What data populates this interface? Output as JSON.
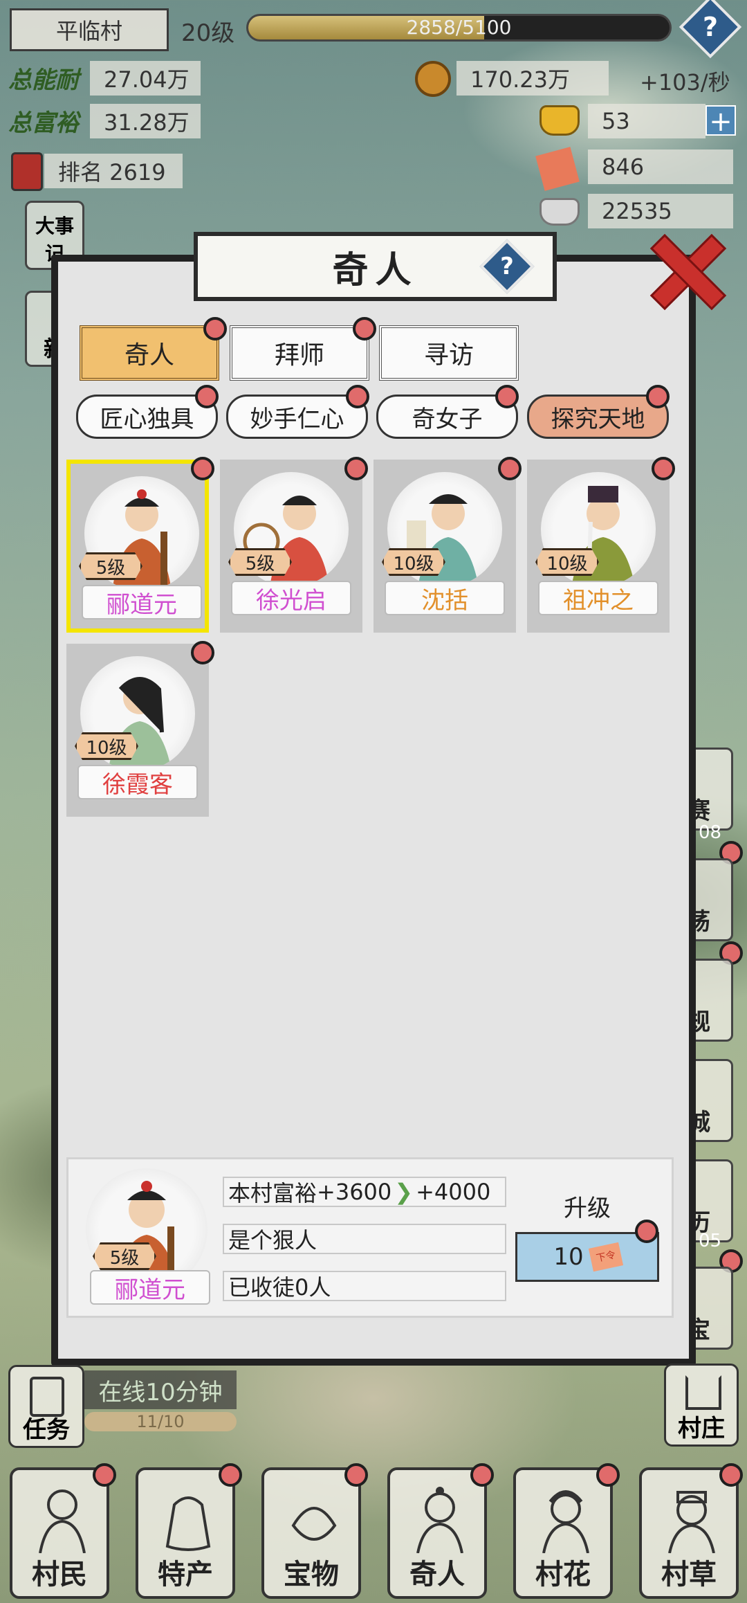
{
  "hud": {
    "village": "平临村",
    "level": "20级",
    "exp_text": "2858/5100",
    "exp_progress": 0.56,
    "talent_label": "总能耐",
    "talent_value": "27.04万",
    "wealth_label": "总富裕",
    "wealth_value": "31.28万",
    "rank": "排名 2619",
    "coins": "170.23万",
    "coin_rate": "+103/秒",
    "gold": "53",
    "tickets": "846",
    "silver": "22535",
    "help_glyph": "?",
    "plus_glyph": "+"
  },
  "left_side": {
    "item1": "大事记",
    "item2": "新"
  },
  "right_side": [
    "赛",
    "荡",
    "规",
    "城",
    "历",
    "宝"
  ],
  "right_side_counts": {
    "sai": "08",
    "li": "05"
  },
  "modal": {
    "title": "奇人",
    "help_glyph": "?",
    "tabs": [
      {
        "label": "奇人",
        "active": true
      },
      {
        "label": "拜师",
        "active": false
      },
      {
        "label": "寻访",
        "active": false
      }
    ],
    "categories": [
      {
        "label": "匠心独具",
        "active": false
      },
      {
        "label": "妙手仁心",
        "active": false
      },
      {
        "label": "奇女子",
        "active": false
      },
      {
        "label": "探究天地",
        "active": true
      }
    ],
    "cards": [
      {
        "name": "郦道元",
        "level": "5级",
        "color": "#d04fd0",
        "selected": true
      },
      {
        "name": "徐光启",
        "level": "5级",
        "color": "#d04fd0",
        "selected": false
      },
      {
        "name": "沈括",
        "level": "10级",
        "color": "#e2902b",
        "selected": false
      },
      {
        "name": "祖冲之",
        "level": "10级",
        "color": "#e2902b",
        "selected": false
      },
      {
        "name": "徐霞客",
        "level": "10级",
        "color": "#e04040",
        "selected": false
      }
    ],
    "detail": {
      "name": "郦道元",
      "level": "5级",
      "bonus_label": "本村富裕",
      "bonus_current": "+3600",
      "bonus_next": "+4000",
      "motto": "是个狠人",
      "disciples": "已收徒0人",
      "upgrade_label": "升级",
      "upgrade_cost": "10",
      "ticket_icon_text": "下令"
    }
  },
  "quest": {
    "label": "任务",
    "online_text": "在线10分钟",
    "progress_text": "11/10"
  },
  "village_btn": "村庄",
  "nav": [
    "村民",
    "特产",
    "宝物",
    "奇人",
    "村花",
    "村草"
  ]
}
